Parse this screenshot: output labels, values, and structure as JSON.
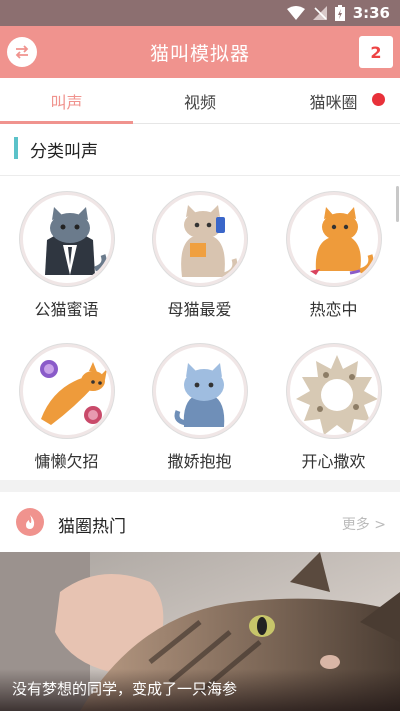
{
  "status_bar": {
    "time": "3:36"
  },
  "app_bar": {
    "title": "猫叫模拟器",
    "count": "2"
  },
  "tabs": [
    {
      "label": "叫声"
    },
    {
      "label": "视频"
    },
    {
      "label": "猫咪圈"
    }
  ],
  "section": {
    "title": "分类叫声"
  },
  "sounds": [
    {
      "label": "公猫蜜语"
    },
    {
      "label": "母猫最爱"
    },
    {
      "label": "热恋中"
    },
    {
      "label": "慵懒欠招"
    },
    {
      "label": "撒娇抱抱"
    },
    {
      "label": "开心撒欢"
    }
  ],
  "hot": {
    "title": "猫圈热门",
    "more": "更多 >"
  },
  "banner": {
    "caption": "没有梦想的同学，变成了一只海参"
  },
  "colors": {
    "accent": "#f0938e",
    "section_bar": "#5bc2c9",
    "badge_red": "#e8313a"
  }
}
